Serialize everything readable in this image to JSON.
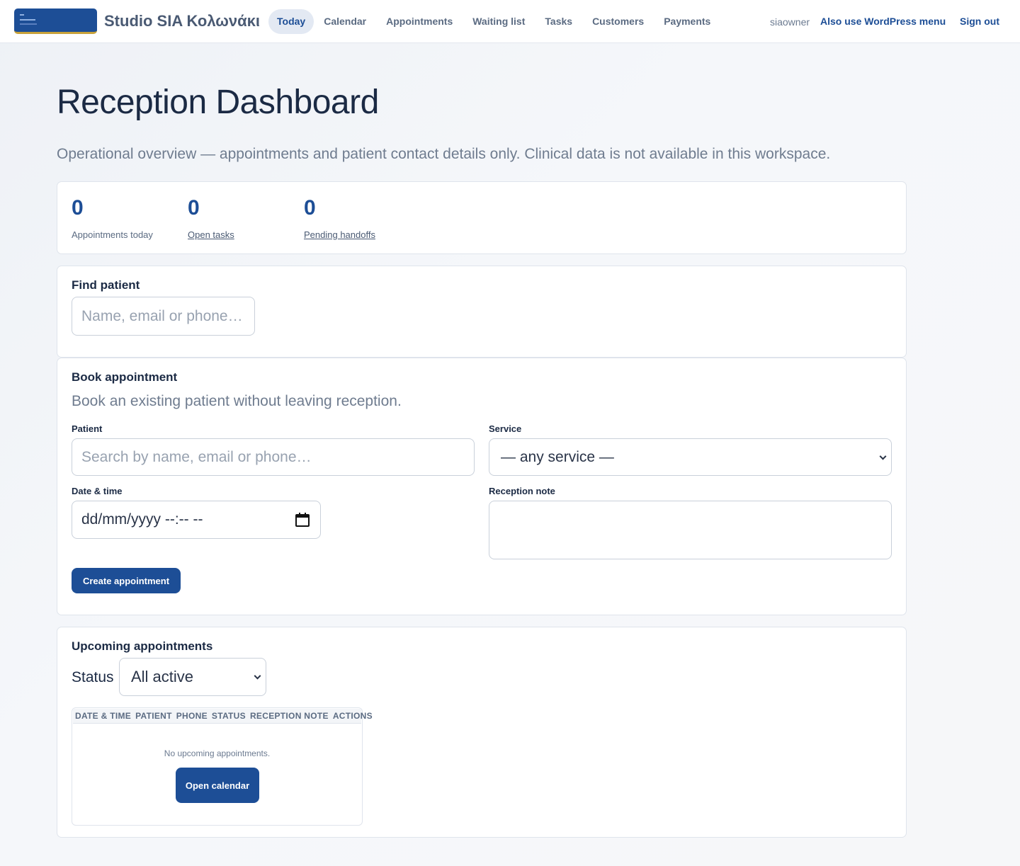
{
  "header": {
    "brand": "Studio SIA Κολωνάκι",
    "nav": [
      "Today",
      "Calendar",
      "Appointments",
      "Waiting list",
      "Tasks",
      "Customers",
      "Payments"
    ],
    "active_nav": "Today",
    "user": "siaowner",
    "wp_menu_link": "Also use WordPress menu",
    "sign_out": "Sign out"
  },
  "page": {
    "title": "Reception Dashboard",
    "subtitle": "Operational overview — appointments and patient contact details only. Clinical data is not available in this workspace."
  },
  "stats": [
    {
      "value": "0",
      "label": "Appointments today"
    },
    {
      "value": "0",
      "label": "Open tasks"
    },
    {
      "value": "0",
      "label": "Pending handoffs"
    }
  ],
  "find_patient": {
    "title": "Find patient",
    "placeholder": "Name, email or phone…"
  },
  "book": {
    "title": "Book appointment",
    "description": "Book an existing patient without leaving reception.",
    "patient_label": "Patient",
    "patient_placeholder": "Search by name, email or phone…",
    "service_label": "Service",
    "service_value": "— any service —",
    "datetime_label": "Date & time",
    "datetime_placeholder": "dd/mm/yyyy --:-- --",
    "note_label": "Reception note",
    "note_value": "",
    "submit": "Create appointment"
  },
  "upcoming": {
    "title": "Upcoming appointments",
    "status_label": "Status",
    "status_value": "All active",
    "columns": [
      "DATE & TIME",
      "PATIENT",
      "PHONE",
      "STATUS",
      "RECEPTION NOTE",
      "ACTIONS"
    ],
    "empty_text": "No upcoming appointments.",
    "open_calendar": "Open calendar"
  },
  "colors": {
    "accent": "#1d4e96",
    "text": "#1b2a44",
    "muted": "#6f7c8f"
  },
  "icons": {
    "date_picker": "calendar-icon",
    "select": "chevron-down-icon"
  }
}
